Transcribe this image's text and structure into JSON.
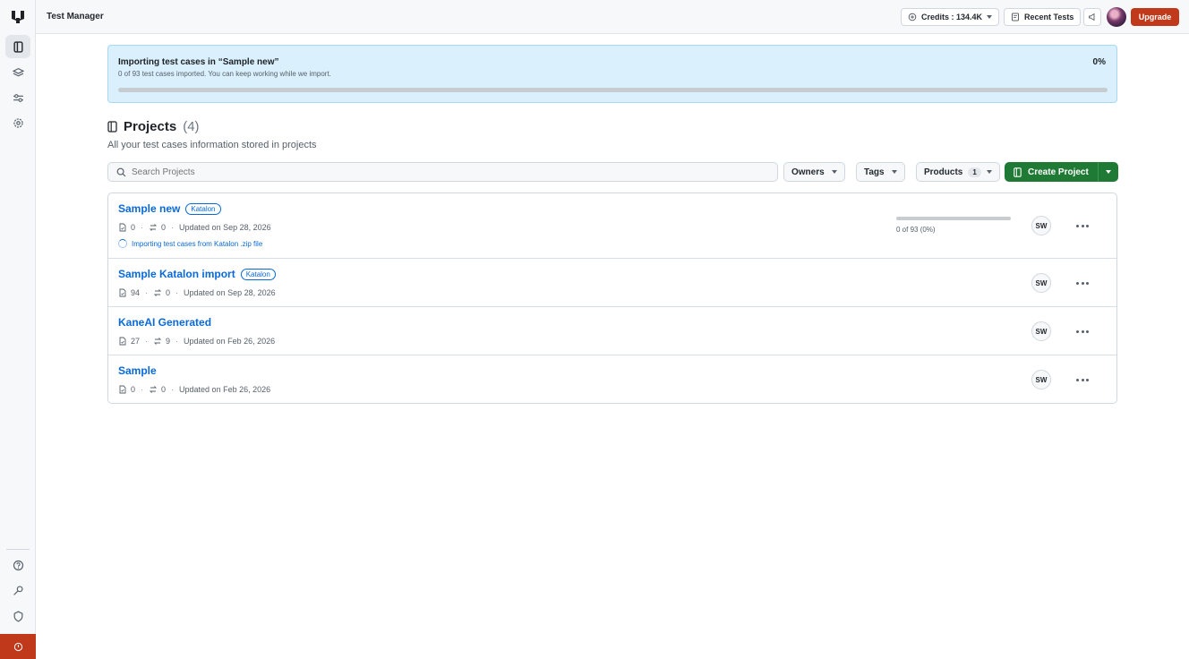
{
  "app": {
    "title": "Test Manager"
  },
  "topbar": {
    "credits_label": "Credits : 134.4K",
    "recent_tests_label": "Recent Tests",
    "upgrade_label": "Upgrade"
  },
  "banner": {
    "title": "Importing test cases in “Sample new”",
    "subtitle": "0 of 93 test cases imported. You can keep working while we import.",
    "percent_label": "0%",
    "progress": 0
  },
  "projects": {
    "title": "Projects",
    "count_label": "(4)",
    "subtitle": "All your test cases information stored in projects",
    "search_placeholder": "Search Projects",
    "filters": {
      "owners": "Owners",
      "tags": "Tags",
      "products": "Products",
      "products_count": "1"
    },
    "create_label": "Create Project",
    "items": [
      {
        "name": "Sample new",
        "tag": "Katalon",
        "test_cases": "0",
        "test_runs": "0",
        "updated": "Updated on Sep 28, 2026",
        "status": "Importing test cases from Katalon .zip file",
        "progress_text": "0 of 93 (0%)",
        "progress": 0,
        "owner": "SW"
      },
      {
        "name": "Sample Katalon import",
        "tag": "Katalon",
        "test_cases": "94",
        "test_runs": "0",
        "updated": "Updated on Sep 28, 2026",
        "owner": "SW"
      },
      {
        "name": "KaneAI Generated",
        "test_cases": "27",
        "test_runs": "9",
        "updated": "Updated on Feb 26, 2026",
        "owner": "SW"
      },
      {
        "name": "Sample",
        "test_cases": "0",
        "test_runs": "0",
        "updated": "Updated on Feb 26, 2026",
        "owner": "SW"
      }
    ]
  },
  "colors": {
    "brand": "#c0391b",
    "primary_action": "#1f7a35",
    "link": "#0969da",
    "banner_bg": "#daf0fd"
  },
  "icons": {
    "sidebar_top": [
      "projects-icon",
      "layers-icon",
      "settings-sliders-icon",
      "gear-icon"
    ],
    "sidebar_bottom": [
      "help-icon",
      "key-icon",
      "shield-icon",
      "power-icon"
    ]
  }
}
